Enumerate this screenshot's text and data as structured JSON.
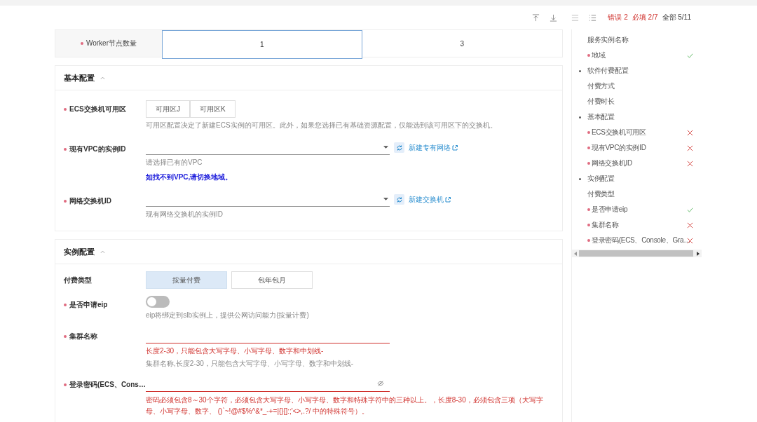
{
  "top_bar": {
    "counts": [
      {
        "text": "错误 2",
        "kind": "error"
      },
      {
        "text": "必填 2/7",
        "kind": "error"
      },
      {
        "text": "全部 5/11",
        "kind": "total"
      }
    ]
  },
  "worker_row": {
    "label": "Worker节点数量",
    "required": true,
    "options": [
      {
        "label": "1",
        "selected": true
      },
      {
        "label": "3",
        "selected": false
      }
    ]
  },
  "sections": [
    {
      "title": "基本配置",
      "expanded": true,
      "fields": [
        {
          "kind": "segmented",
          "label": "ECS交换机可用区",
          "required": true,
          "options": [
            {
              "label": "可用区J",
              "selected": false
            },
            {
              "label": "可用区K",
              "selected": false
            }
          ],
          "hint": "可用区配置决定了新建ECS实例的可用区。此外，如果您选择已有基础资源配置，仅能选到该可用区下的交换机。"
        },
        {
          "kind": "select",
          "label": "现有VPC的实例ID",
          "required": true,
          "link": "新建专有网络",
          "hint": "请选择已有的VPC",
          "note": "如找不到VPC,请切换地域。"
        },
        {
          "kind": "select",
          "label": "网络交换机ID",
          "required": true,
          "link": "新建交换机",
          "hint": "现有网络交换机的实例ID"
        }
      ]
    },
    {
      "title": "实例配置",
      "expanded": true,
      "fields": [
        {
          "kind": "segmented",
          "label": "付费类型",
          "required": false,
          "wide": true,
          "options": [
            {
              "label": "按量付费",
              "selected": true
            },
            {
              "label": "包年包月",
              "selected": false
            }
          ]
        },
        {
          "kind": "toggle",
          "label": "是否申请eip",
          "required": true,
          "on": false,
          "hint": "eip将绑定到slb实例上，提供公网访问能力(按量计费)"
        },
        {
          "kind": "text",
          "label": "集群名称",
          "required": true,
          "error": "长度2-30，只能包含大写字母、小写字母、数字和中划线-",
          "hint": "集群名称,长度2-30，只能包含大写字母、小写字母、数字和中划线-"
        },
        {
          "kind": "password",
          "label": "登录密码(ECS、Cons…",
          "required": true,
          "error": "密码必须包含8～30个字符，必须包含大写字母、小写字母、数字和特殊字符中的三种以上。，长度8-30，必须包含三项（大写字母、小写字母、数字、 ()`~!@#$%^&*_-+=|{}[]:;'<>,.?/ 中的特殊符号）。"
        }
      ]
    }
  ],
  "nav": {
    "items": [
      {
        "label": "服务实例名称",
        "kind": "plain",
        "valid": false,
        "invalid": false
      },
      {
        "label": "地域",
        "kind": "required",
        "valid": true,
        "invalid": false
      },
      {
        "label": "软件付费配置",
        "kind": "group",
        "valid": false,
        "invalid": false
      },
      {
        "label": "付费方式",
        "kind": "plain",
        "valid": false,
        "invalid": false
      },
      {
        "label": "付费时长",
        "kind": "plain",
        "valid": false,
        "invalid": false
      },
      {
        "label": "基本配置",
        "kind": "group",
        "valid": false,
        "invalid": false
      },
      {
        "label": "ECS交换机可用区",
        "kind": "required",
        "valid": false,
        "invalid": true
      },
      {
        "label": "现有VPC的实例ID",
        "kind": "required",
        "valid": false,
        "invalid": true
      },
      {
        "label": "网络交换机ID",
        "kind": "required",
        "valid": false,
        "invalid": true
      },
      {
        "label": "实例配置",
        "kind": "group",
        "valid": false,
        "invalid": false
      },
      {
        "label": "付费类型",
        "kind": "plain",
        "valid": false,
        "invalid": false
      },
      {
        "label": "是否申请eip",
        "kind": "required",
        "valid": true,
        "invalid": false
      },
      {
        "label": "集群名称",
        "kind": "required",
        "valid": false,
        "invalid": true
      },
      {
        "label": "登录密码(ECS、Console、Gra…",
        "kind": "required",
        "valid": false,
        "invalid": true
      }
    ]
  }
}
